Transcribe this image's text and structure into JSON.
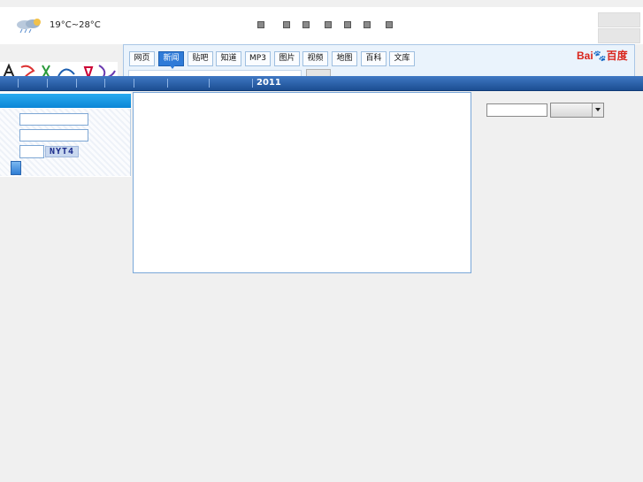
{
  "header": {
    "weather_icon": "cloud-rain-icon",
    "temperature": "19°C~28°C",
    "nav_bullets": [
      "bullet-icon",
      "bullet-icon",
      "bullet-icon",
      "bullet-icon",
      "bullet-icon",
      "bullet-icon",
      "bullet-icon"
    ]
  },
  "search": {
    "tabs": [
      {
        "label": "网页"
      },
      {
        "label": "新闻"
      },
      {
        "label": "贴吧"
      },
      {
        "label": "知道"
      },
      {
        "label": "MP3"
      },
      {
        "label": "图片"
      },
      {
        "label": "视频"
      },
      {
        "label": "地图"
      },
      {
        "label": "百科"
      },
      {
        "label": "文库"
      }
    ],
    "active_tab_index": 1,
    "logo_text": "Bai",
    "logo_paw": "🐾",
    "logo_suffix": "百度",
    "query": ""
  },
  "navbar": {
    "year": "2011"
  },
  "login": {
    "username": "",
    "password": "",
    "captcha_value": "",
    "captcha_text": "NYT4"
  },
  "right_search": {
    "query": "",
    "select_value": ""
  },
  "colors": {
    "navbar": "#1c4e92",
    "active_tab": "#2f7bd8",
    "panel_border": "#79a7d8",
    "baidu_red": "#d9251c",
    "baidu_blue": "#2b53c4"
  }
}
